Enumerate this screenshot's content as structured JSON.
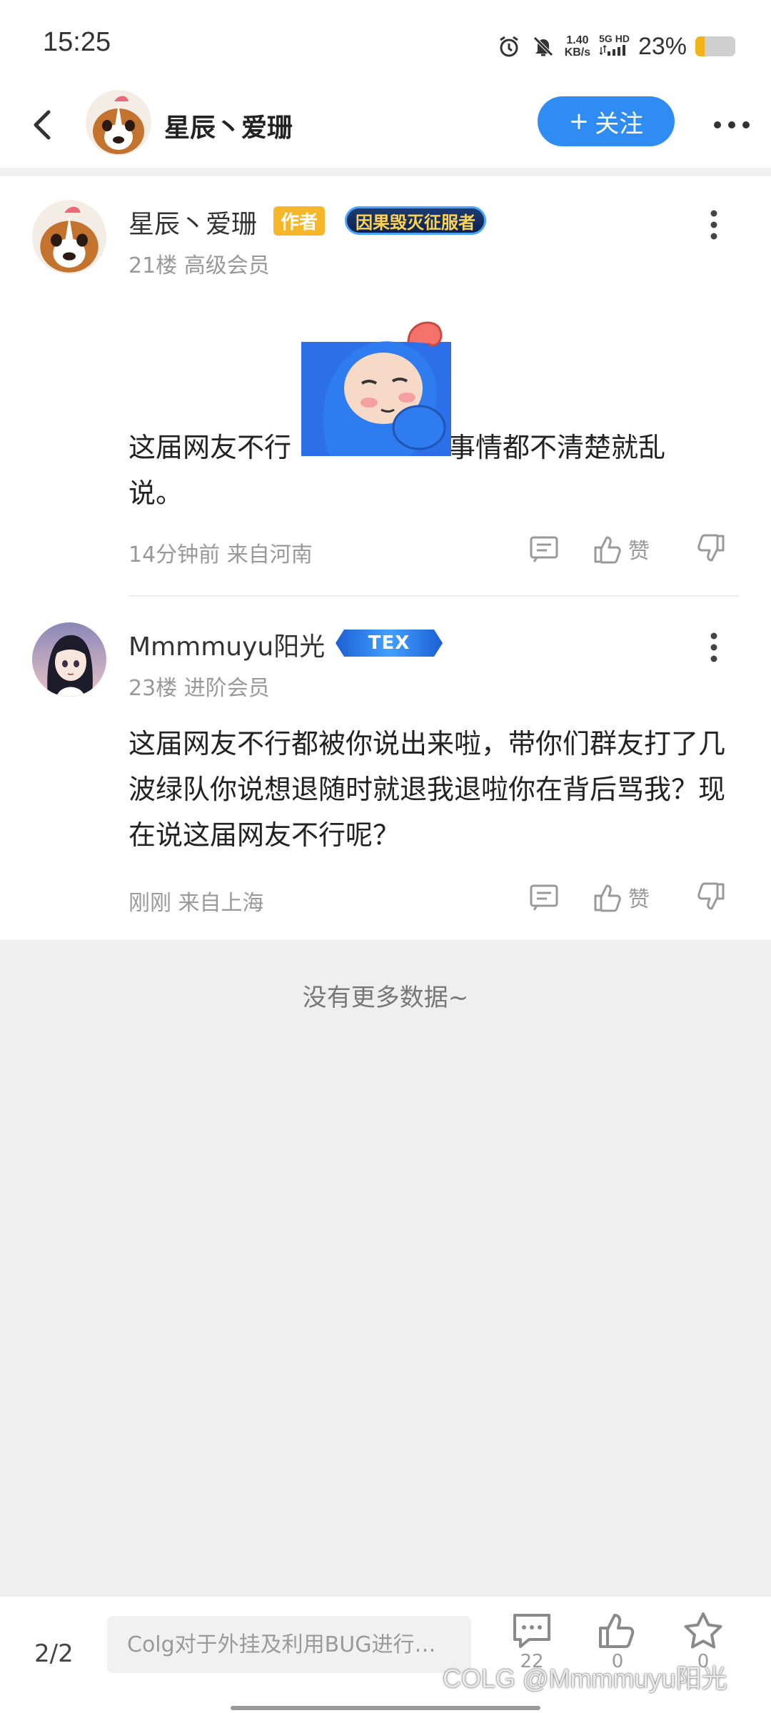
{
  "status_bar": {
    "time": "15:25",
    "net_speed_value": "1.40",
    "net_speed_unit": "KB/s",
    "net_type": "5G HD",
    "battery_percent_text": "23%",
    "battery_level": 0.23
  },
  "header": {
    "username": "星辰丶爱珊",
    "follow_label": "关注"
  },
  "posts": [
    {
      "username": "星辰丶爱珊",
      "author_badge": "作者",
      "title_badge": "因果毁灭征服者",
      "meta": "21楼 高级会员",
      "text_line1_a": "这届网友不行",
      "text_line1_b": "事情都不清楚就乱",
      "text_line2": "说。",
      "time_location": "14分钟前 来自河南",
      "like_label": "赞"
    },
    {
      "username": "Mmmmuyu阳光",
      "title_badge": "TEX",
      "meta": "23楼 进阶会员",
      "text": "这届网友不行都被你说出来啦，带你们群友打了几波绿队你说想退随时就退我退啦你在背后骂我？现在说这届网友不行呢？",
      "time_location": "刚刚 来自上海",
      "like_label": "赞"
    }
  ],
  "no_more_text": "没有更多数据~",
  "bottom_bar": {
    "page_indicator": "2/2",
    "input_placeholder": "Colg对于外挂及利用BUG进行…",
    "comment_count": "22",
    "like_count": "0",
    "favorite_count": "0"
  },
  "watermark": "COLG @Mmmmuyu阳光",
  "colors": {
    "accent_blue": "#2f8cf3",
    "author_badge": "#f5b62a",
    "battery_fill": "#f2b317"
  }
}
